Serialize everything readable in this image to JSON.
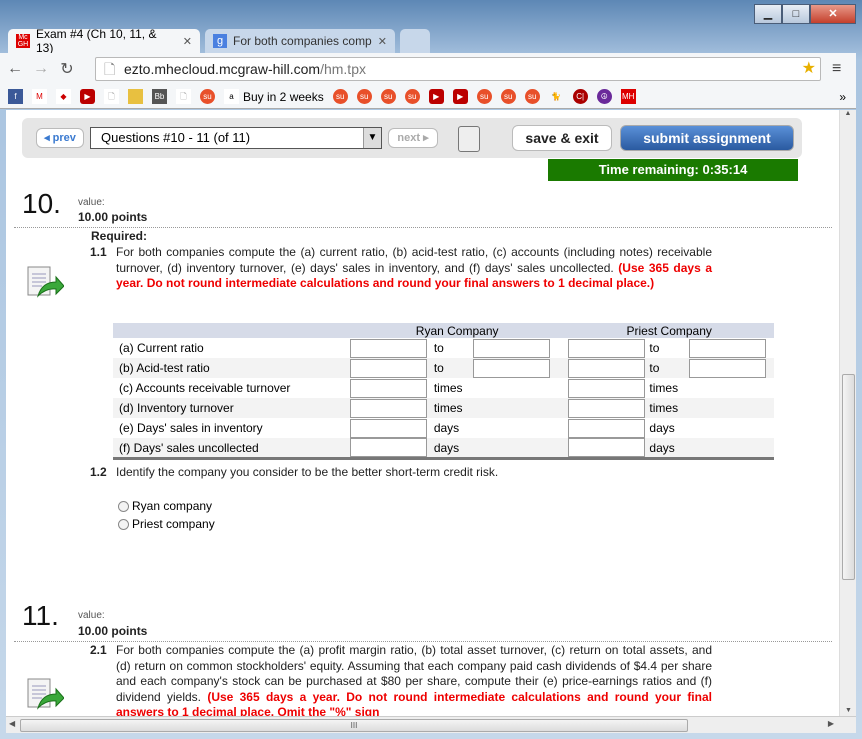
{
  "browser": {
    "tabs": [
      {
        "label": "Exam #4 (Ch 10, 11, & 13)",
        "active": true
      },
      {
        "label": "For both companies comp",
        "active": false
      }
    ],
    "url_host": "ezto.mhecloud.mcgraw-hill.com",
    "url_path": "/hm.tpx",
    "bookmark_text": "Buy in 2 weeks",
    "more": "»"
  },
  "toolbar": {
    "prev": "◂ prev",
    "selector": "Questions #10 - 11 (of 11)",
    "next": "next ▸",
    "save_exit": "save & exit",
    "submit": "submit assignment",
    "timer": "Time remaining: 0:35:14"
  },
  "q10": {
    "number": "10.",
    "value_label": "value:",
    "points": "10.00 points",
    "required": "Required:",
    "p11_num": "1.1",
    "p11_text_a": "For both companies compute the (a) current ratio, (b) acid-test ratio, (c) accounts (including notes) receivable turnover, (d) inventory turnover, (e) days' sales in inventory, and (f) days' sales uncollected.",
    "p11_text_red": "(Use 365 days a year. Do not round intermediate calculations and round your final answers to 1 decimal place.)",
    "table": {
      "headers": [
        "Ryan Company",
        "Priest Company"
      ],
      "rows": [
        {
          "label": "(a)  Current ratio",
          "unit": "to",
          "pair": true
        },
        {
          "label": "(b)  Acid-test ratio",
          "unit": "to",
          "pair": true
        },
        {
          "label": "(c)  Accounts receivable turnover",
          "unit": "times",
          "pair": false
        },
        {
          "label": "(d)  Inventory turnover",
          "unit": "times",
          "pair": false
        },
        {
          "label": "(e)  Days' sales in inventory",
          "unit": "days",
          "pair": false
        },
        {
          "label": "(f)  Days' sales uncollected",
          "unit": "days",
          "pair": false
        }
      ]
    },
    "p12_num": "1.2",
    "p12_text": "Identify the company you consider to be the better short-term credit risk.",
    "options": [
      "Ryan company",
      "Priest company"
    ]
  },
  "q11": {
    "number": "11.",
    "value_label": "value:",
    "points": "10.00 points",
    "p21_num": "2.1",
    "p21_text_a": "For both companies compute the (a) profit margin ratio, (b) total asset turnover, (c) return on total assets, and (d) return on common stockholders' equity. Assuming that each company paid cash dividends of $4.4 per share and each company's stock can be purchased at $80 per share, compute their (e) price-earnings ratios and (f) dividend yields.",
    "p21_text_red": "(Use 365 days a year. Do not round intermediate calculations and round your final answers to 1 decimal place. Omit the \"%\" sign"
  }
}
